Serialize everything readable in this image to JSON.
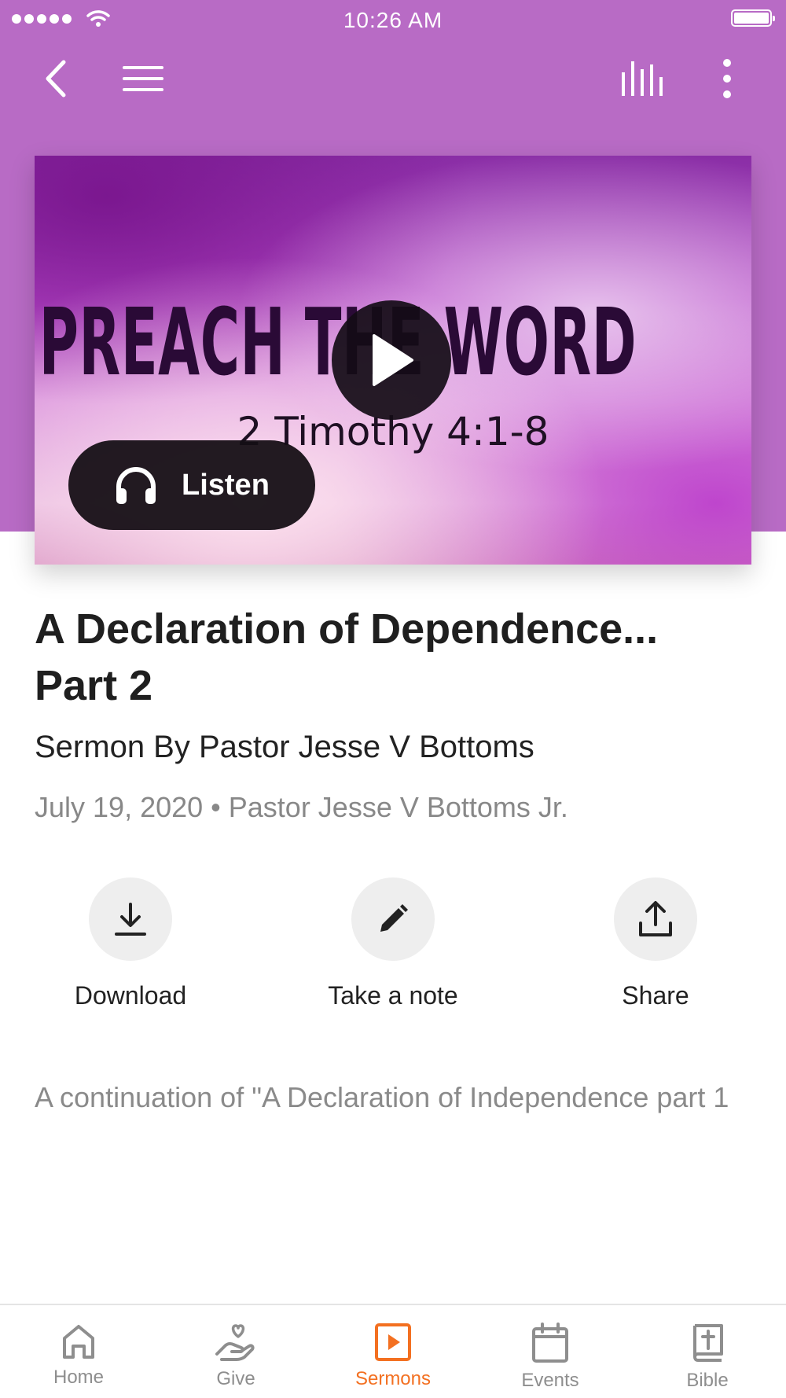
{
  "status_bar": {
    "time": "10:26 AM"
  },
  "hero": {
    "artwork_title": "PREACH THE WORD",
    "artwork_subtitle": "2 Timothy 4:1-8",
    "listen_label": "Listen"
  },
  "sermon": {
    "title": "A Declaration of Dependence... Part 2",
    "subtitle": "Sermon By Pastor Jesse V Bottoms",
    "meta": "July 19, 2020 • Pastor Jesse V Bottoms Jr.",
    "description": "A continuation of \"A Declaration of Independence part 1"
  },
  "actions": {
    "download": "Download",
    "note": "Take a note",
    "share": "Share"
  },
  "tabs": [
    {
      "label": "Home",
      "icon": "home-icon"
    },
    {
      "label": "Give",
      "icon": "give-icon"
    },
    {
      "label": "Sermons",
      "icon": "sermons-icon",
      "active": true
    },
    {
      "label": "Events",
      "icon": "calendar-icon"
    },
    {
      "label": "Bible",
      "icon": "bible-icon"
    }
  ],
  "colors": {
    "header": "#b86bc5",
    "accent": "#f37021",
    "inactive": "#8e8e8e"
  }
}
